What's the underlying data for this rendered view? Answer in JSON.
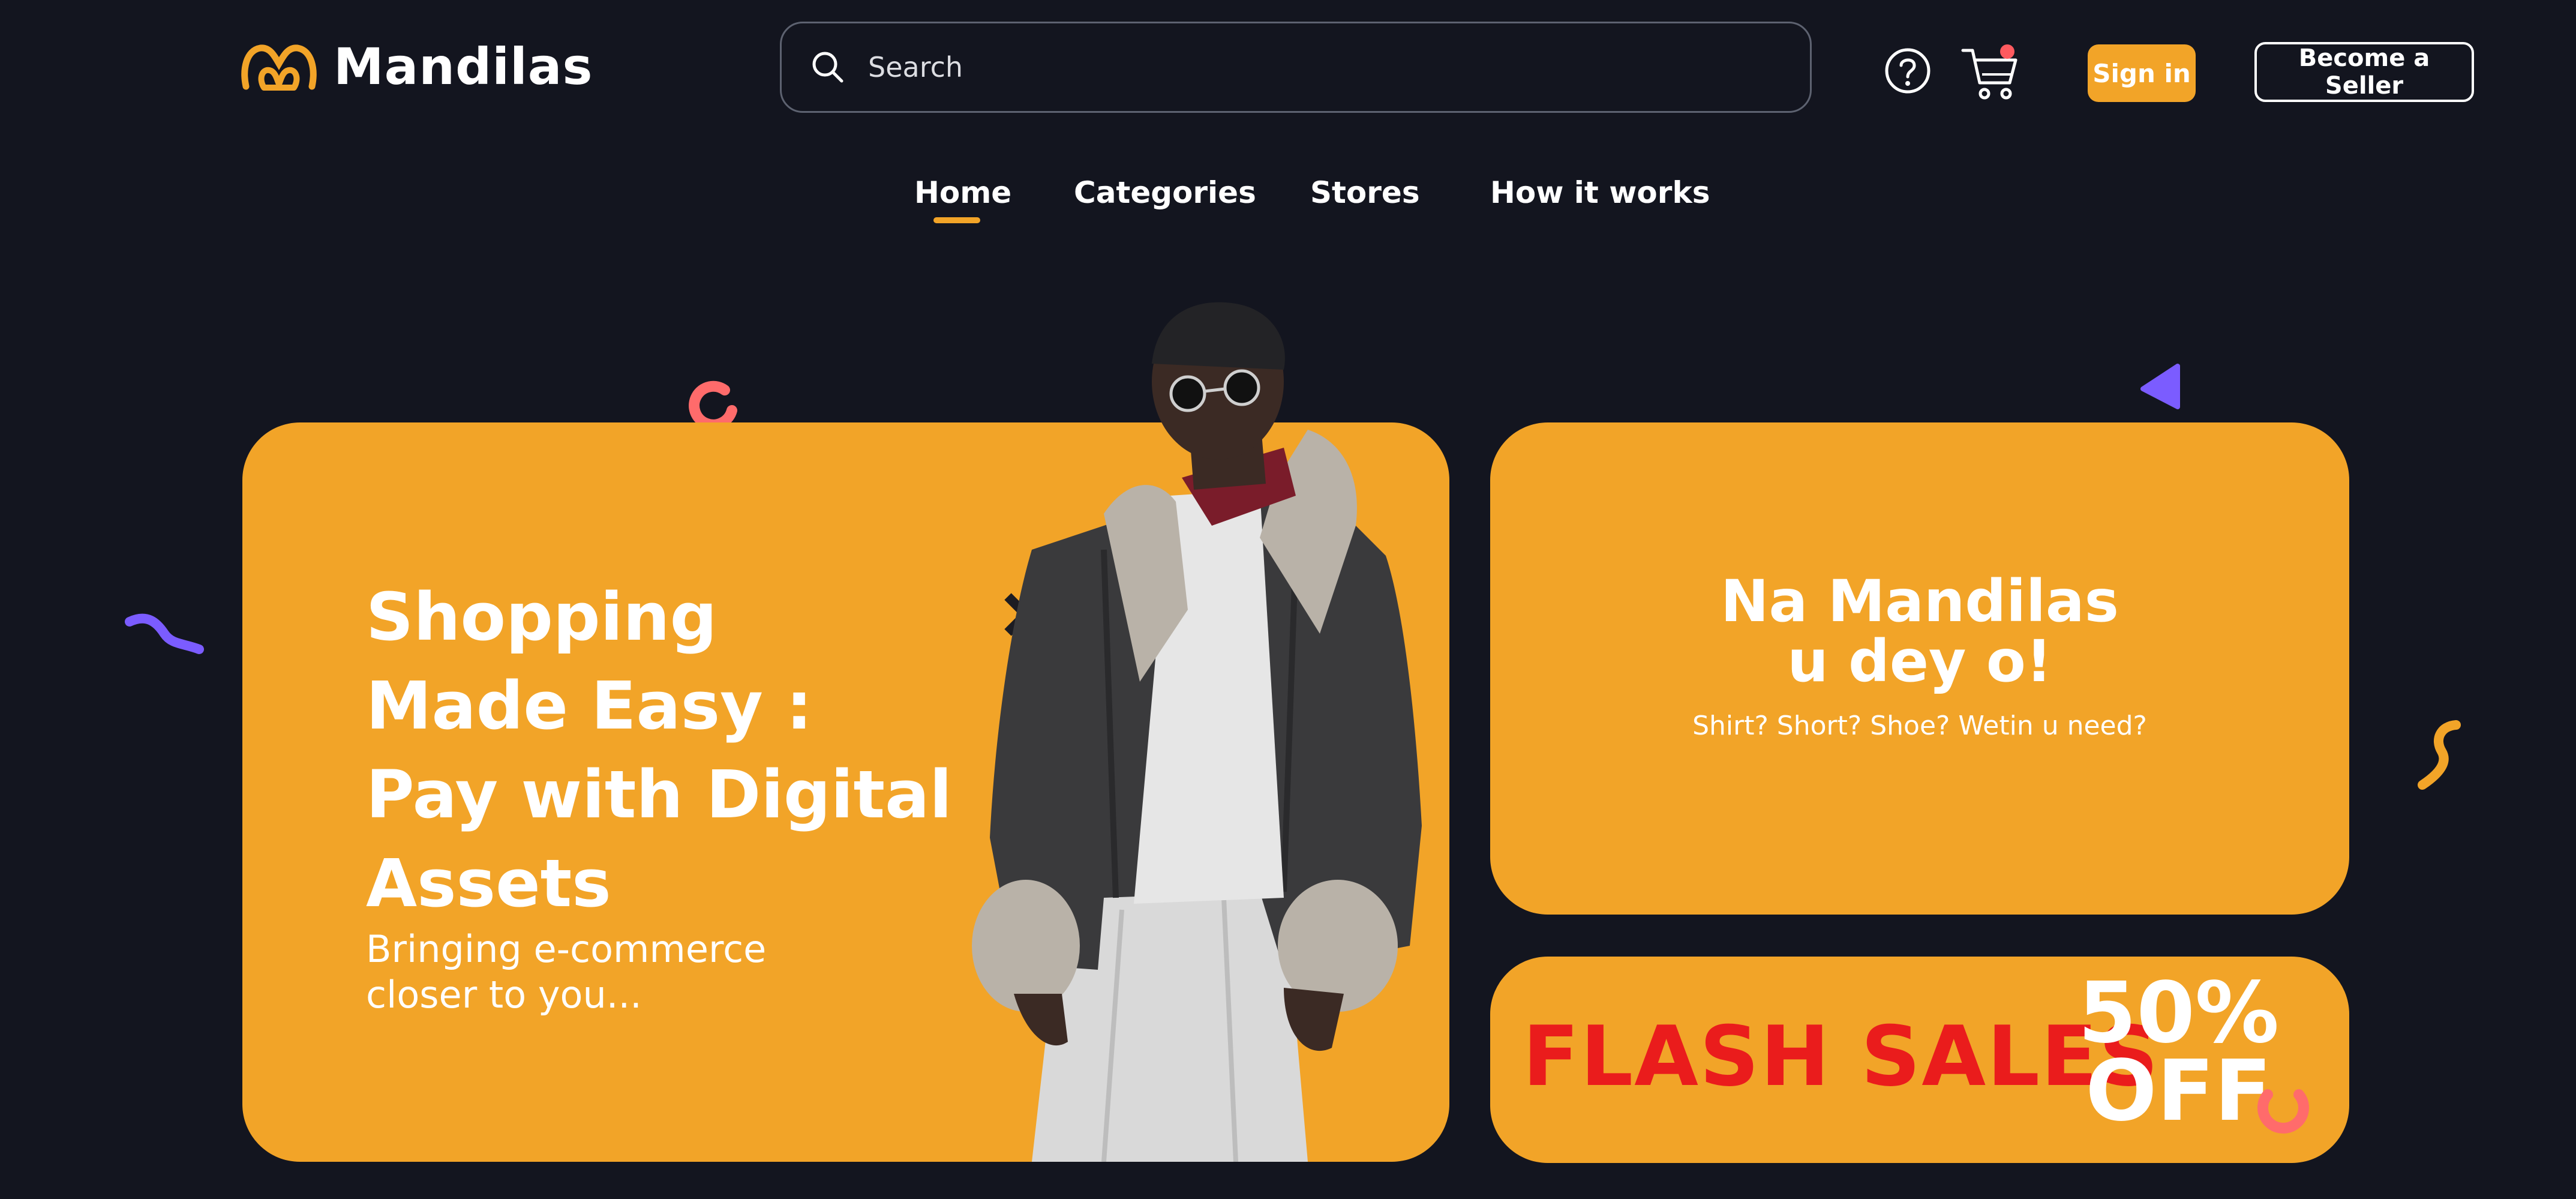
{
  "brand": {
    "name": "Mandilas",
    "accent": "#f2a428",
    "background": "#13151f"
  },
  "search": {
    "placeholder": "Search",
    "icon": "search-icon"
  },
  "header": {
    "help_icon": "help-circle-icon",
    "cart_icon": "cart-icon",
    "cart_badge_color": "#ff5a5f",
    "signin_label": "Sign in",
    "seller_label": "Become a Seller"
  },
  "nav": {
    "items": [
      {
        "label": "Home",
        "active": true
      },
      {
        "label": "Categories"
      },
      {
        "label": "Stores"
      },
      {
        "label": "How it works"
      }
    ]
  },
  "hero": {
    "title_lines": [
      "Shopping",
      "Made Easy :",
      "Pay with Digital",
      "Assets"
    ],
    "subtitle_lines": [
      "Bringing e-commerce",
      "closer to you..."
    ]
  },
  "promo": {
    "title_lines": [
      "Na Mandilas",
      "u dey o!"
    ],
    "subtitle": "Shirt? Short? Shoe? Wetin u need?"
  },
  "flash": {
    "label": "FLASH SALES",
    "percent": "50%",
    "off": "OFF",
    "label_color": "#ea1c1c"
  },
  "decor": {
    "colors": {
      "coral": "#ff6b6b",
      "purple": "#7b5cff",
      "orange": "#f2a428"
    }
  }
}
